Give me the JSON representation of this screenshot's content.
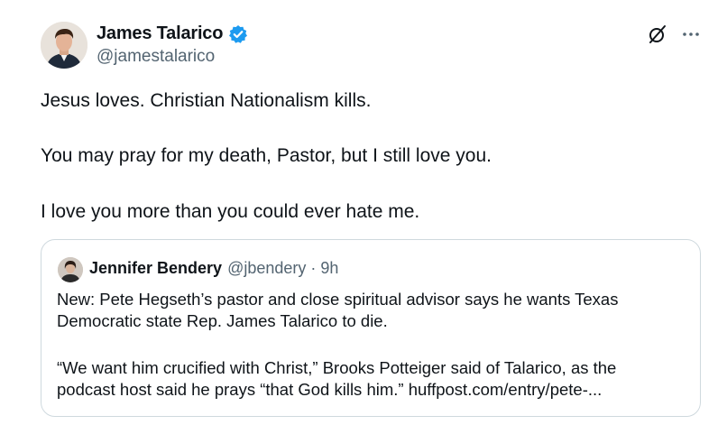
{
  "author": {
    "name": "James Talarico",
    "handle": "@jamestalarico",
    "verified": true,
    "badge_color": "#1d9bf0",
    "avatar_icon": "profile-photo"
  },
  "tweet": {
    "lines": [
      "Jesus loves. Christian Nationalism kills.",
      "You may pray for my death, Pastor, but I still love you.",
      "I love you more than you could ever hate me."
    ]
  },
  "actions": {
    "grok_icon": "grok-icon",
    "more_icon": "more-icon"
  },
  "quoted_tweet": {
    "name": "Jennifer Bendery",
    "handle": "@jbendery",
    "separator": "·",
    "time": "9h",
    "lines": [
      "New: Pete Hegseth’s pastor and close spiritual advisor says he wants Texas",
      "Democratic state Rep. James Talarico to die.",
      "“We want him crucified with Christ,” Brooks Potteiger said of Talarico, as the",
      "podcast host said he prays “that God kills him.” huffpost.com/entry/pete-..."
    ]
  },
  "colors": {
    "text": "#0f1419",
    "secondary": "#536471",
    "border": "#cfd9de"
  }
}
